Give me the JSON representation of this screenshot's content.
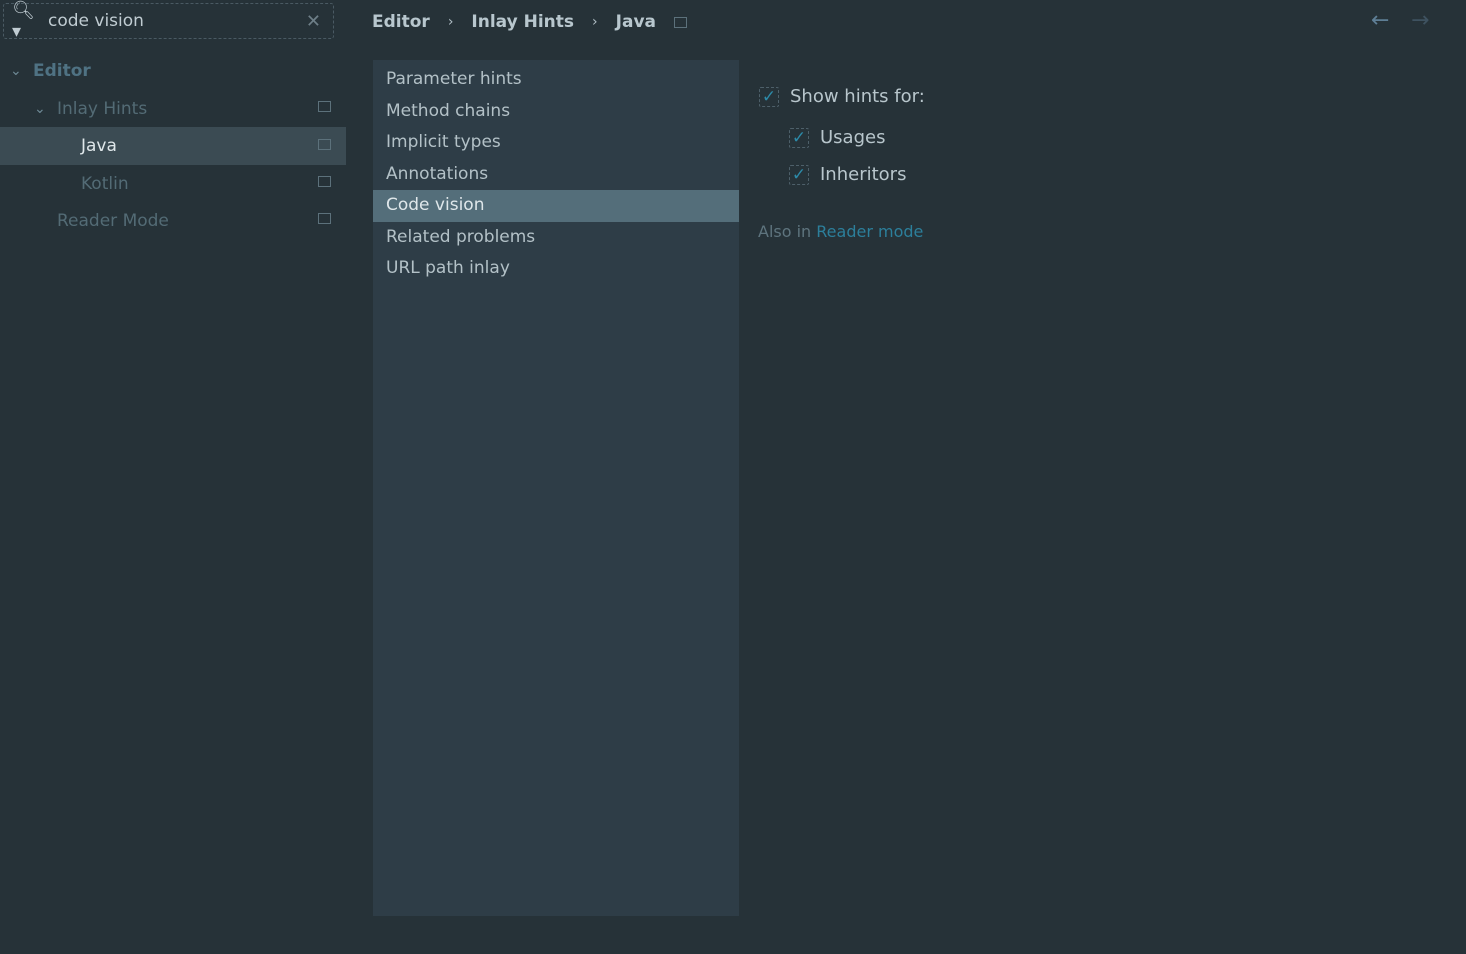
{
  "search": {
    "value": "code vision"
  },
  "tree": [
    {
      "label": "Editor",
      "level": 0,
      "expanded": true
    },
    {
      "label": "Inlay Hints",
      "level": 1,
      "expanded": true
    },
    {
      "label": "Java",
      "level": 2,
      "selected": true
    },
    {
      "label": "Kotlin",
      "level": 2
    },
    {
      "label": "Reader Mode",
      "level": 1
    }
  ],
  "breadcrumb": [
    "Editor",
    "Inlay Hints",
    "Java"
  ],
  "nav": {
    "back": "←",
    "forward": "→"
  },
  "hint_list": [
    "Parameter hints",
    "Method chains",
    "Implicit types",
    "Annotations",
    "Code vision",
    "Related problems",
    "URL path inlay"
  ],
  "active_hint": "Code vision",
  "options": {
    "show_hints_label": "Show hints for:",
    "usages": "Usages",
    "inheritors": "Inheritors",
    "checked": [
      true,
      true,
      true
    ]
  },
  "also": {
    "prefix": "Also in",
    "link": "Reader mode"
  }
}
